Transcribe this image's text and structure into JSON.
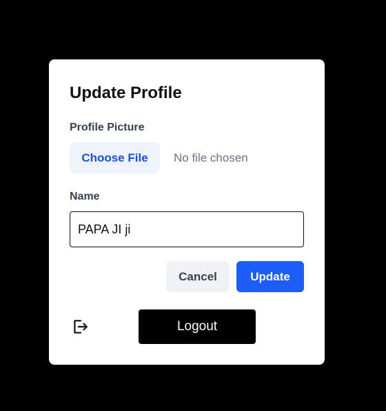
{
  "dialog": {
    "title": "Update Profile"
  },
  "profile_picture": {
    "label": "Profile Picture",
    "choose_button_label": "Choose File",
    "status_text": "No file chosen"
  },
  "name_field": {
    "label": "Name",
    "value": "PAPA JI ji"
  },
  "actions": {
    "cancel_label": "Cancel",
    "update_label": "Update"
  },
  "footer": {
    "logout_icon": "logout-icon",
    "logout_label": "Logout"
  },
  "colors": {
    "backdrop": "#000000",
    "dialog_bg": "#ffffff",
    "primary": "#1c5ef7",
    "choose_file_bg": "#eef4fe",
    "choose_file_text": "#1d4ed8",
    "cancel_bg": "#f1f2f4",
    "logout_bg": "#000000"
  }
}
